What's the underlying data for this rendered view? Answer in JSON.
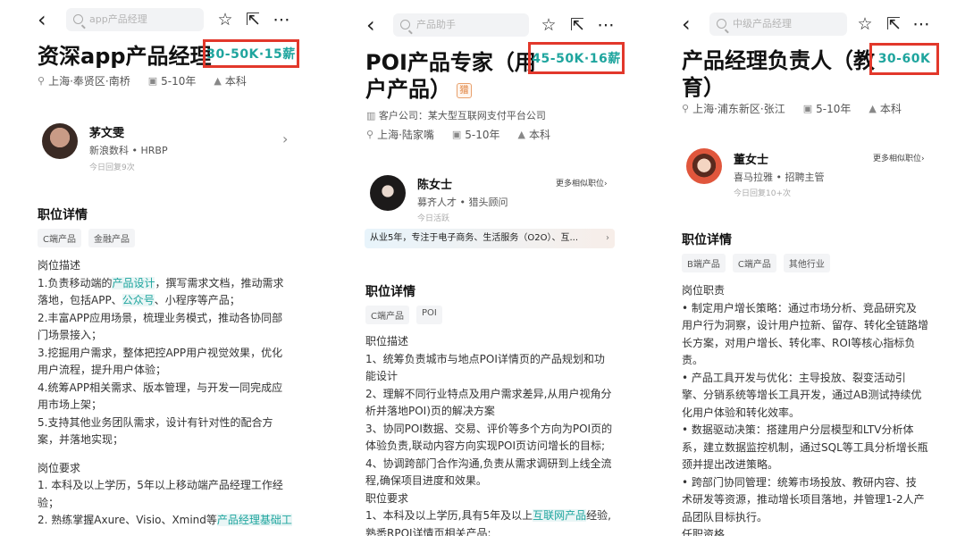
{
  "panel1": {
    "search_placeholder": "app产品经理",
    "title": "资深app产品经理",
    "salary": "30-50K·15薪",
    "location": "上海·奉贤区·南桥",
    "experience": "5-10年",
    "education": "本科",
    "recruiter": {
      "name": "茅文雯",
      "company_role": "新浪数科 • HRBP",
      "reply": "今日回复9次"
    },
    "section_title": "职位详情",
    "tags": [
      "C端产品",
      "金融产品"
    ],
    "desc_heading": "岗位描述",
    "desc_lines": [
      {
        "pre": "1.负责移动端的",
        "hl": "产品设计",
        "post": "，撰写需求文档，推动需求"
      },
      {
        "pre": "落地，包括APP、",
        "hl": "公众号",
        "post": "、小程序等产品；"
      },
      {
        "pre": "2.丰富APP应用场景，梳理业务模式，推动各协同部",
        "hl": "",
        "post": ""
      },
      {
        "pre": "门场景接入；",
        "hl": "",
        "post": ""
      },
      {
        "pre": "3.挖掘用户需求，整体把控APP用户视觉效果，优化",
        "hl": "",
        "post": ""
      },
      {
        "pre": "用户流程，提升用户体验；",
        "hl": "",
        "post": ""
      },
      {
        "pre": "4.统筹APP相关需求、版本管理，与开发一同完成应",
        "hl": "",
        "post": ""
      },
      {
        "pre": "用市场上架；",
        "hl": "",
        "post": ""
      },
      {
        "pre": "5.支持其他业务团队需求，设计有针对性的配合方",
        "hl": "",
        "post": ""
      },
      {
        "pre": "案，并落地实现；",
        "hl": "",
        "post": ""
      }
    ],
    "req_heading": "岗位要求",
    "req_lines": [
      {
        "pre": "1. 本科及以上学历，5年以上移动端产品经理工作经",
        "hl": "",
        "post": ""
      },
      {
        "pre": "验；",
        "hl": "",
        "post": ""
      },
      {
        "pre": "2. 熟练掌握Axure、Visio、Xmind等",
        "hl": "产品经理基础工",
        "post": ""
      }
    ]
  },
  "panel2": {
    "search_placeholder": "产品助手",
    "title_line1": "POI产品专家（用",
    "title_line2": "户产品）",
    "badge": "猎",
    "salary": "45-50K·16薪",
    "client": "客户公司：某大型互联网支付平台公司",
    "location": "上海·陆家嘴",
    "experience": "5-10年",
    "education": "本科",
    "recruiter": {
      "name": "陈女士",
      "company_role": "募齐人才 • 猎头顾问",
      "reply": "今日活跃",
      "more": "更多相似职位"
    },
    "blurb": "从业5年，专注于电子商务、生活服务（O2O）、互...",
    "section_title": "职位详情",
    "tags": [
      "C端产品",
      "POI"
    ],
    "desc_heading": "职位描述",
    "desc_lines": [
      {
        "pre": "1、统筹负责城市与地点POI详情页的产品规划和功",
        "hl": "",
        "post": ""
      },
      {
        "pre": "能设计",
        "hl": "",
        "post": ""
      },
      {
        "pre": "2、理解不同行业特点及用户需求差异,从用户视角分",
        "hl": "",
        "post": ""
      },
      {
        "pre": "析并落地POI)页的解决方案",
        "hl": "",
        "post": ""
      },
      {
        "pre": "3、协同POI数据、交易、评价等多个方向为POI页的",
        "hl": "",
        "post": ""
      },
      {
        "pre": "体验负责,联动内容方向实现POI页访问增长的目标;",
        "hl": "",
        "post": ""
      },
      {
        "pre": "4、协调跨部门合作沟通,负责从需求调研到上线全流",
        "hl": "",
        "post": ""
      },
      {
        "pre": "程,确保项目进度和效果。",
        "hl": "",
        "post": ""
      },
      {
        "pre": "职位要求",
        "hl": "",
        "post": ""
      },
      {
        "pre": "1、本科及以上学历,具有5年及以上",
        "hl": "互联网产品",
        "post": "经验,"
      },
      {
        "pre": "熟悉RPOI详情页相关产品;",
        "hl": "",
        "post": ""
      }
    ]
  },
  "panel3": {
    "search_placeholder": "中级产品经理",
    "title_line1": "产品经理负责人（教",
    "title_line2": "育）",
    "salary": "30-60K",
    "location": "上海·浦东新区·张江",
    "experience": "5-10年",
    "education": "本科",
    "recruiter": {
      "name": "董女士",
      "company_role": "喜马拉雅 • 招聘主管",
      "reply": "今日回复10+次",
      "more": "更多相似职位"
    },
    "section_title": "职位详情",
    "tags": [
      "B端产品",
      "C端产品",
      "其他行业"
    ],
    "desc_heading": "岗位职责",
    "desc_lines": [
      {
        "pre": "  • 制定用户增长策略：通过市场分析、竞品研究及",
        "hl": "",
        "post": ""
      },
      {
        "pre": "用户行为洞察，设计用户拉新、留存、转化全链路增",
        "hl": "",
        "post": ""
      },
      {
        "pre": "长方案，对用户增长、转化率、ROI等核心指标负",
        "hl": "",
        "post": ""
      },
      {
        "pre": "责。",
        "hl": "",
        "post": ""
      },
      {
        "pre": "  • 产品工具开发与优化：主导投放、裂变活动引",
        "hl": "",
        "post": ""
      },
      {
        "pre": "擎、分销系统等增长工具开发，通过AB测试持续优",
        "hl": "",
        "post": ""
      },
      {
        "pre": "化用户体验和转化效率。",
        "hl": "",
        "post": ""
      },
      {
        "pre": "  • 数据驱动决策：搭建用户分层模型和LTV分析体",
        "hl": "",
        "post": ""
      },
      {
        "pre": "系，建立数据监控机制，通过SQL等工具分析增长瓶",
        "hl": "",
        "post": ""
      },
      {
        "pre": "颈并提出改进策略。",
        "hl": "",
        "post": ""
      },
      {
        "pre": "  • 跨部门协同管理：统筹市场投放、教研内容、技",
        "hl": "",
        "post": ""
      },
      {
        "pre": "术研发等资源，推动增长项目落地，并管理1-2人产",
        "hl": "",
        "post": ""
      },
      {
        "pre": "品团队目标执行。",
        "hl": "",
        "post": ""
      },
      {
        "pre": "任职资格",
        "hl": "",
        "post": ""
      }
    ]
  },
  "icons": {
    "back": "chevron-left-icon",
    "star": "star-icon",
    "share": "share-icon",
    "more": "more-icon",
    "location": "location-pin-icon",
    "briefcase": "briefcase-icon",
    "education": "graduation-cap-icon",
    "client": "building-icon"
  },
  "colors": {
    "salary": "#1fa59e",
    "highlight_box": "#e2382b"
  }
}
